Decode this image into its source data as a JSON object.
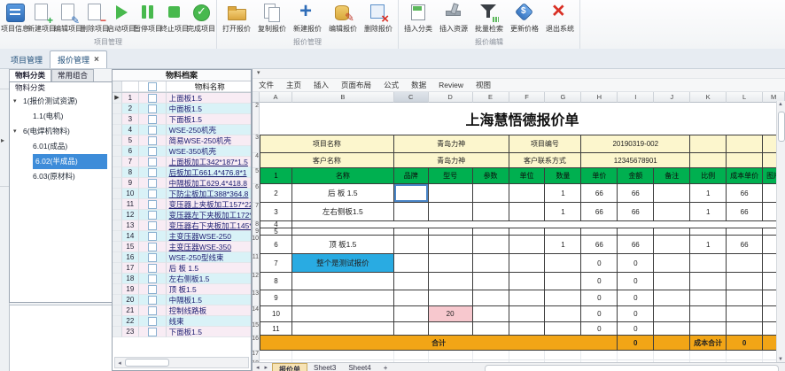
{
  "colors": {
    "header_green": "#00B050",
    "total_gold": "#F2A516",
    "info_yellow": "#FCF6CD",
    "note_cyan": "#29ABE2",
    "model_pink": "#F7C8CE",
    "selection_blue": "#3D8CD9",
    "row_pink": "#F8ECF4",
    "row_cyan": "#D9F2F7"
  },
  "ribbon": {
    "groups": [
      {
        "label": "项目管理",
        "buttons": [
          {
            "label": "项目信息",
            "icon": "project-info"
          },
          {
            "label": "新建项目",
            "icon": "doc-plus"
          },
          {
            "label": "编辑项目",
            "icon": "doc-edit"
          },
          {
            "label": "删除项目",
            "icon": "doc-minus"
          },
          {
            "label": "启动项目",
            "icon": "play"
          },
          {
            "label": "暂停项目",
            "icon": "pause"
          },
          {
            "label": "终止项目",
            "icon": "stop"
          },
          {
            "label": "完成项目",
            "icon": "check"
          }
        ]
      },
      {
        "label": "报价管理",
        "buttons": [
          {
            "label": "打开报价",
            "icon": "folder-open"
          },
          {
            "label": "复制报价",
            "icon": "copy"
          },
          {
            "label": "新建报价",
            "icon": "plus"
          },
          {
            "label": "编辑报价",
            "icon": "db-edit"
          },
          {
            "label": "删除报价",
            "icon": "doc-delete"
          }
        ]
      },
      {
        "label": "报价编辑",
        "buttons": [
          {
            "label": "插入分类",
            "icon": "insert-category"
          },
          {
            "label": "插入资源",
            "icon": "insert-resource"
          },
          {
            "label": "批量检索",
            "icon": "filter"
          },
          {
            "label": "更新价格",
            "icon": "price-tag"
          },
          {
            "label": "退出系统",
            "icon": "exit"
          }
        ]
      }
    ]
  },
  "doc_tabs": [
    {
      "label": "项目管理",
      "active": false
    },
    {
      "label": "报价管理",
      "active": true,
      "close_glyph": "×"
    }
  ],
  "left_panel": {
    "tabs": [
      {
        "label": "物料分类",
        "active": true
      },
      {
        "label": "常用组合",
        "active": false
      }
    ],
    "tree_caption": "物料分类",
    "tree": [
      {
        "label": "1(报价测试资源)",
        "level": 0,
        "expander": "▾",
        "selected": false
      },
      {
        "label": "1.1(电机)",
        "level": 1,
        "selected": false
      },
      {
        "label": "6(电焊机物料)",
        "level": 0,
        "expander": "▾",
        "selected": false
      },
      {
        "label": "6.01(成品)",
        "level": 1,
        "selected": false
      },
      {
        "label": "6.02(半成品)",
        "level": 1,
        "selected": true
      },
      {
        "label": "6.03(原材料)",
        "level": 1,
        "selected": false
      }
    ]
  },
  "materials": {
    "title": "物料档案",
    "name_header": "物料名称",
    "rows": [
      {
        "num": "1",
        "name": "上面板1.5",
        "indicator": "▶",
        "underline": false
      },
      {
        "num": "2",
        "name": "中面板1.5",
        "underline": false
      },
      {
        "num": "3",
        "name": "下面板1.5",
        "underline": false
      },
      {
        "num": "4",
        "name": "WSE-250机壳",
        "underline": false
      },
      {
        "num": "5",
        "name": "简易WSE-250机壳",
        "underline": false
      },
      {
        "num": "6",
        "name": "WSE-350机壳",
        "underline": false
      },
      {
        "num": "7",
        "name": "上面板加工342*187*1.5",
        "underline": true
      },
      {
        "num": "8",
        "name": "后板加工661.4*476.8*1",
        "underline": true
      },
      {
        "num": "9",
        "name": "中隔板加工629.4*418.8",
        "underline": true
      },
      {
        "num": "10",
        "name": "下防尘板加工388*364.8",
        "underline": true
      },
      {
        "num": "11",
        "name": "变压器上夹板加工157*22",
        "underline": true
      },
      {
        "num": "12",
        "name": "变压器左下夹板加工172*",
        "underline": true
      },
      {
        "num": "13",
        "name": "变压器右下夹板加工145*",
        "underline": true
      },
      {
        "num": "14",
        "name": "主变压器WSE-250",
        "underline": true
      },
      {
        "num": "15",
        "name": "主变压器WSE-350",
        "underline": true
      },
      {
        "num": "16",
        "name": "WSE-250型线束",
        "underline": false
      },
      {
        "num": "17",
        "name": "后 板 1.5",
        "underline": false
      },
      {
        "num": "18",
        "name": "左右侧板1.5",
        "underline": false
      },
      {
        "num": "19",
        "name": "顶 板1.5",
        "underline": false
      },
      {
        "num": "20",
        "name": "中隔板1.5",
        "underline": false
      },
      {
        "num": "21",
        "name": "控制线路板",
        "underline": false
      },
      {
        "num": "22",
        "name": "线束",
        "underline": false
      },
      {
        "num": "23",
        "name": "下面板1.5",
        "underline": false
      }
    ]
  },
  "spreadsheet": {
    "quick_access_glyph": "▾",
    "menu": [
      "文件",
      "主页",
      "插入",
      "页面布局",
      "公式",
      "数据",
      "Review",
      "视图"
    ],
    "columns": [
      "A",
      "B",
      "C",
      "D",
      "E",
      "F",
      "G",
      "H",
      "I",
      "J",
      "K",
      "L",
      "M"
    ],
    "active_column": "C",
    "row_numbers": [
      "2",
      "3",
      "4",
      "5",
      "6",
      "7",
      "8",
      "9",
      "10",
      "11",
      "12",
      "13",
      "14",
      "15",
      "16",
      "17",
      "18"
    ],
    "title": "上海慧悟德报价单",
    "info_rows": [
      {
        "label1": "项目名称",
        "value1": "青岛力神",
        "label2": "项目编号",
        "value2": "20190319-002"
      },
      {
        "label1": "客户名称",
        "value1": "青岛力神",
        "label2": "客户联系方式",
        "value2": "12345678901"
      }
    ],
    "header_row": [
      "1",
      "名称",
      "品牌",
      "型号",
      "参数",
      "单位",
      "数量",
      "单价",
      "金额",
      "备注",
      "比例",
      "成本单价",
      "图片"
    ],
    "data_rows": [
      {
        "row": "6",
        "idx": "2",
        "name": "后 板 1.5",
        "qty": "1",
        "price": "66",
        "amount": "66",
        "ratio": "1",
        "cost": "66",
        "selected_cell": "C"
      },
      {
        "row": "7",
        "idx": "3",
        "name": "左右侧板1.5",
        "qty": "1",
        "price": "66",
        "amount": "66",
        "ratio": "1",
        "cost": "66"
      },
      {
        "row": "8",
        "idx": "4",
        "thin": true,
        "merged": true
      },
      {
        "row": "9",
        "idx": "5",
        "thin": true
      },
      {
        "row": "10",
        "idx": "6",
        "name": "顶 板1.5",
        "qty": "1",
        "price": "66",
        "amount": "66",
        "ratio": "1",
        "cost": "66"
      },
      {
        "row": "11",
        "idx": "7",
        "name": "整个是测试报价",
        "name_bg": "cyan",
        "price": "0",
        "amount": "0"
      },
      {
        "row": "12",
        "idx": "8",
        "price": "0",
        "amount": "0"
      },
      {
        "row": "13",
        "idx": "9",
        "price": "0",
        "amount": "0"
      },
      {
        "row": "14",
        "idx": "10",
        "model": "20",
        "model_bg": "pink",
        "price": "0",
        "amount": "0"
      },
      {
        "row": "15",
        "idx": "11",
        "price": "0",
        "amount": "0"
      }
    ],
    "total_row": {
      "row": "16",
      "label": "合计",
      "amount": "0",
      "cost_label": "成本合计",
      "cost_value": "0"
    },
    "sheet_tabs": [
      {
        "label": "报价单",
        "active": true
      },
      {
        "label": "Sheet3",
        "active": false
      },
      {
        "label": "Sheet4",
        "active": false
      },
      {
        "label": "+",
        "active": false
      }
    ],
    "scroll_nav_glyphs": "◂ ▸"
  }
}
